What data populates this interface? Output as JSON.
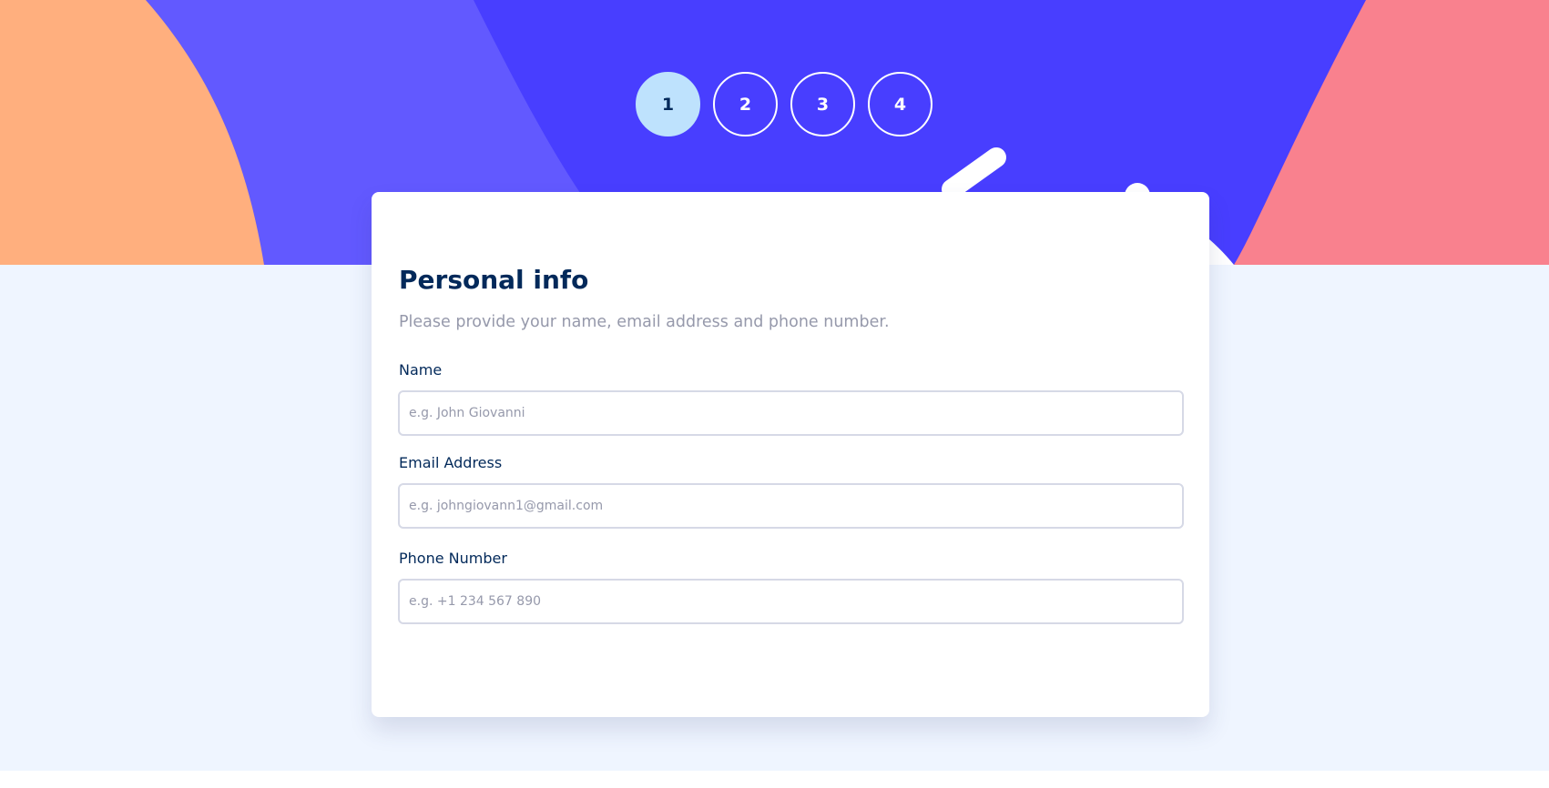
{
  "steps": [
    {
      "number": "1",
      "active": true
    },
    {
      "number": "2",
      "active": false
    },
    {
      "number": "3",
      "active": false
    },
    {
      "number": "4",
      "active": false
    }
  ],
  "form": {
    "title": "Personal info",
    "subtitle": "Please provide your name, email address and phone number.",
    "fields": [
      {
        "label": "Name",
        "placeholder": "e.g. John Giovanni",
        "value": ""
      },
      {
        "label": "Email Address",
        "placeholder": "e.g. johngiovann1@gmail.com",
        "value": ""
      },
      {
        "label": "Phone Number",
        "placeholder": "e.g. +1 234 567 890",
        "value": ""
      }
    ]
  },
  "colors": {
    "hero_purple": "#483eff",
    "hero_light_purple": "#6259ff",
    "hero_orange": "#ffaf7e",
    "hero_pink": "#f9818e",
    "active_step": "#bee2fd",
    "text_primary": "#02295a",
    "text_secondary": "#9699ab",
    "border": "#d6d9e6",
    "page_background": "#eff5ff"
  }
}
